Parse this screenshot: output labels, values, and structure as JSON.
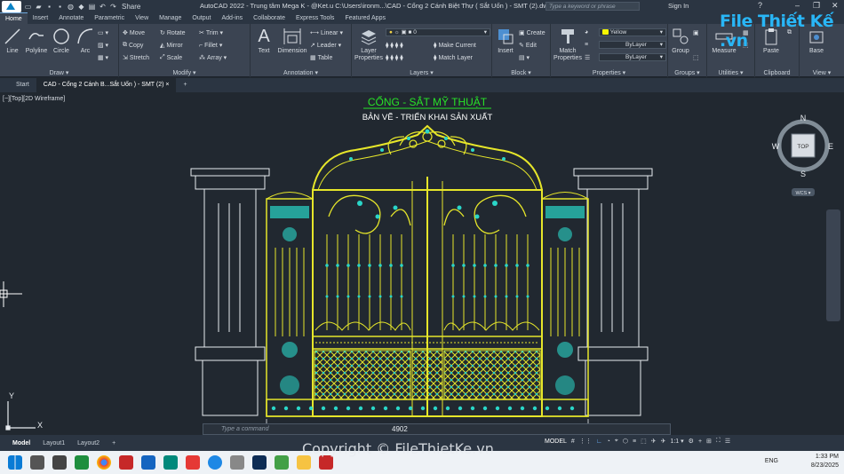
{
  "titlebar": {
    "app_title": "AutoCAD 2022 - Trung tâm Mega K - @Ket.u   C:\\Users\\ironm...\\CAD - Cổng 2 Cánh Biệt Thự ( Sắt Uốn ) - SMT (2).dwg",
    "share": "Share",
    "search_placeholder": "Type a keyword or phrase",
    "signin": "Sign In"
  },
  "ribbon_tabs": [
    "Home",
    "Insert",
    "Annotate",
    "Parametric",
    "View",
    "Manage",
    "Output",
    "Add-ins",
    "Collaborate",
    "Express Tools",
    "Featured Apps"
  ],
  "draw": {
    "label": "Draw ▾",
    "line": "Line",
    "polyline": "Polyline",
    "circle": "Circle",
    "arc": "Arc"
  },
  "modify": {
    "label": "Modify ▾",
    "move": "Move",
    "rotate": "Rotate",
    "trim": "Trim ▾",
    "copy": "Copy",
    "mirror": "Mirror",
    "fillet": "Fillet ▾",
    "stretch": "Stretch",
    "scale": "Scale",
    "array": "Array ▾"
  },
  "annotation": {
    "label": "Annotation ▾",
    "text": "Text",
    "dimension": "Dimension",
    "linear": "Linear ▾",
    "leader": "Leader ▾",
    "table": "Table"
  },
  "layers": {
    "label": "Layers ▾",
    "layer_properties": "Layer Properties",
    "current_layer": "0",
    "make_current": "Make Current",
    "match_layer": "Match Layer"
  },
  "block": {
    "label": "Block ▾",
    "insert": "Insert",
    "create": "Create",
    "edit": "Edit"
  },
  "properties": {
    "label": "Properties ▾",
    "match_properties": "Match Properties",
    "color": "Yellow",
    "linetype": "ByLayer",
    "lineweight": "ByLayer"
  },
  "groups": {
    "label": "Groups ▾",
    "group": "Group"
  },
  "utilities": {
    "label": "Utilities ▾",
    "measure": "Measure"
  },
  "clipboard": {
    "label": "Clipboard",
    "paste": "Paste"
  },
  "view": {
    "label": "View ▾",
    "base": "Base"
  },
  "doc_tabs": {
    "start": "Start",
    "active": "CAD - Cổng 2 Cánh B...Sắt Uốn ) - SMT (2)",
    "close": "×",
    "add": "+"
  },
  "viewport_label": "[−][Top][2D Wireframe]",
  "drawing": {
    "title": "CỔNG - SẮT MỸ THUẬT",
    "subtitle": "BẢN VẼ - TRIỂN KHAI SẢN XUẤT",
    "dimension": "4902"
  },
  "viewcube": {
    "top": "TOP",
    "n": "N",
    "s": "S",
    "e": "E",
    "w": "W",
    "wcs": "WCS ▾"
  },
  "ucs": {
    "x": "X",
    "y": "Y"
  },
  "command_placeholder": "Type a command",
  "layout_tabs": [
    "Model",
    "Layout1",
    "Layout2"
  ],
  "status": {
    "model": "MODEL",
    "scale": "1:1 ▾"
  },
  "tray": {
    "lang": "ENG",
    "time": "1:33 PM",
    "date": "8/23/2025"
  },
  "watermark": {
    "logo": "File Thiết Kế .vn",
    "bottom": "Copyright © FileThietKe.vn"
  },
  "colors": {
    "ribbon": "#3b4452",
    "canvas": "#212830",
    "title_green": "#27e227",
    "cad_yellow": "#e6e62a",
    "cad_cyan": "#2ad6c8"
  }
}
